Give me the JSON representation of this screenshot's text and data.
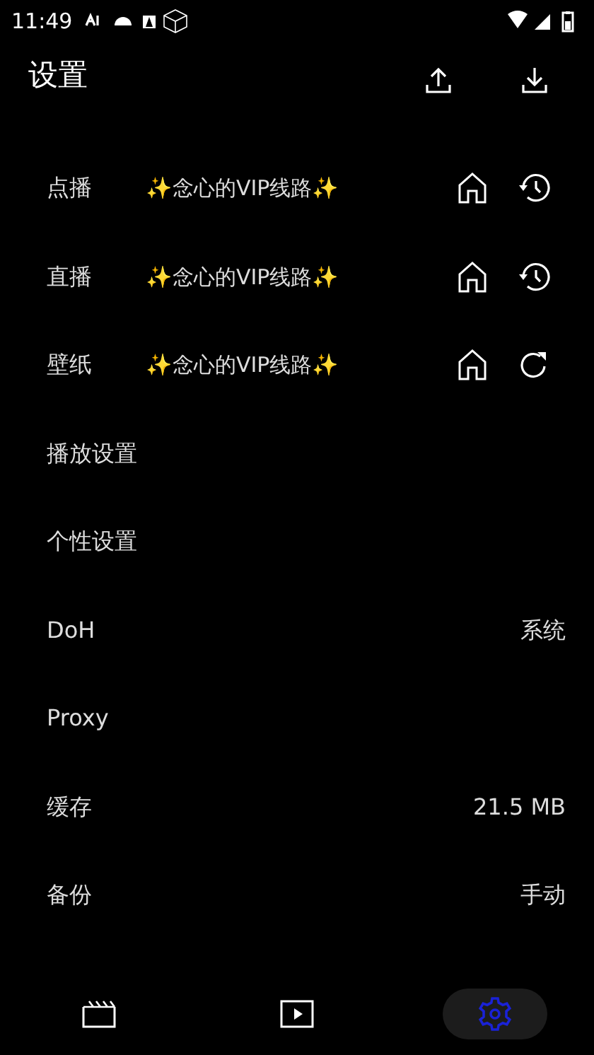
{
  "status_bar": {
    "time": "11:49"
  },
  "header": {
    "title": "设置"
  },
  "settings": [
    {
      "kind": "source",
      "label": "点播",
      "value": "✨念心的VIP线路✨"
    },
    {
      "kind": "source",
      "label": "直播",
      "value": "✨念心的VIP线路✨"
    },
    {
      "kind": "wallpaper",
      "label": "壁纸",
      "value": "✨念心的VIP线路✨"
    },
    {
      "kind": "plain",
      "label": "播放设置"
    },
    {
      "kind": "plain",
      "label": "个性设置"
    },
    {
      "kind": "plain",
      "label": "DoH",
      "value": "系统"
    },
    {
      "kind": "plain",
      "label": "Proxy"
    },
    {
      "kind": "plain",
      "label": "缓存",
      "value": "21.5 MB"
    },
    {
      "kind": "plain",
      "label": "备份",
      "value": "手动"
    }
  ],
  "bottom_nav": [
    {
      "selected": false
    },
    {
      "selected": false
    },
    {
      "selected": true
    }
  ]
}
